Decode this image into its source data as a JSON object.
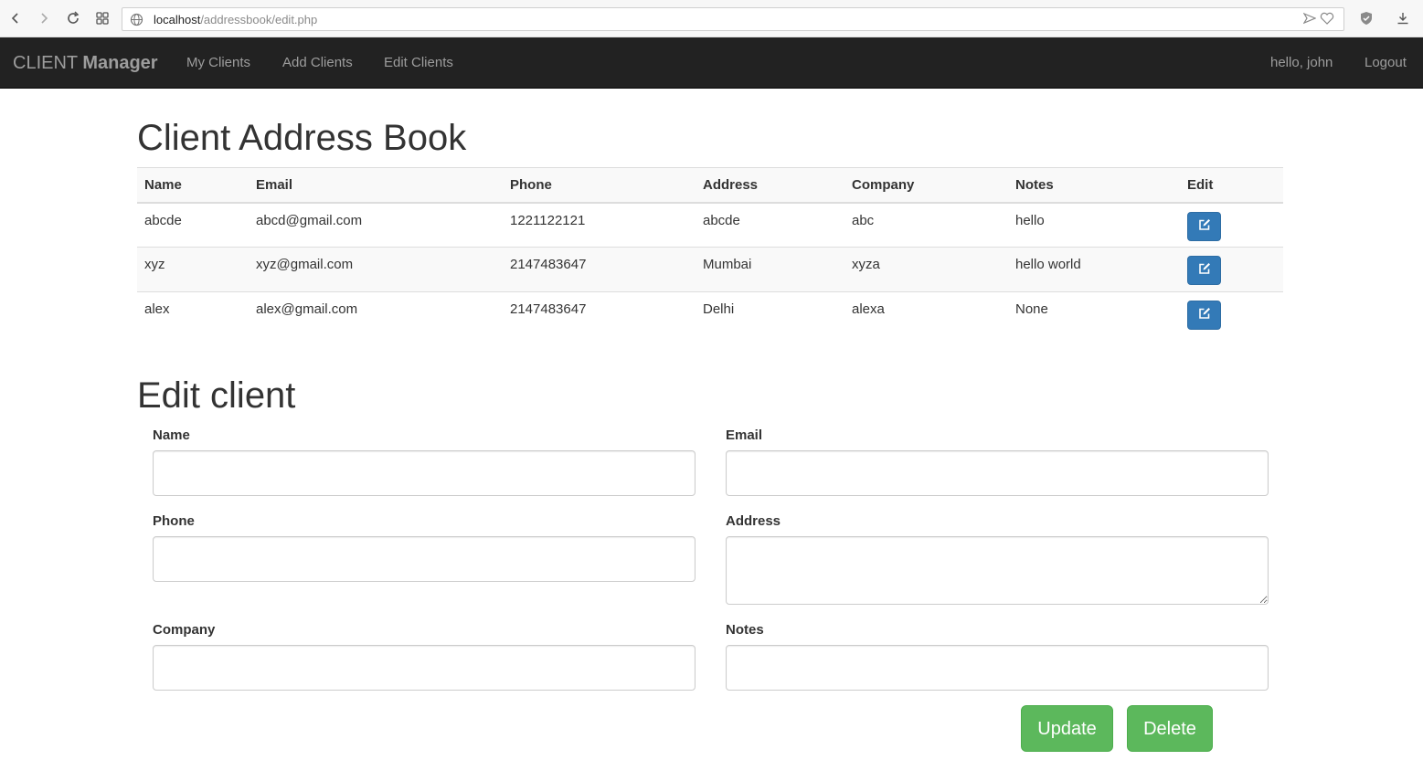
{
  "browser": {
    "url_host": "localhost",
    "url_path": "/addressbook/edit.php"
  },
  "navbar": {
    "brand_light": "CLIENT ",
    "brand_bold": "Manager",
    "links": [
      "My Clients",
      "Add Clients",
      "Edit Clients"
    ],
    "greeting": "hello, john",
    "logout": "Logout"
  },
  "page_title": "Client Address Book",
  "table": {
    "headers": [
      "Name",
      "Email",
      "Phone",
      "Address",
      "Company",
      "Notes",
      "Edit"
    ],
    "rows": [
      {
        "name": "abcde",
        "email": "abcd@gmail.com",
        "phone": "1221122121",
        "address": "abcde",
        "company": "abc",
        "notes": "hello"
      },
      {
        "name": "xyz",
        "email": "xyz@gmail.com",
        "phone": "2147483647",
        "address": "Mumbai",
        "company": "xyza",
        "notes": "hello world"
      },
      {
        "name": "alex",
        "email": "alex@gmail.com",
        "phone": "2147483647",
        "address": "Delhi",
        "company": "alexa",
        "notes": "None"
      }
    ],
    "edit_icon": "edit-square-icon"
  },
  "form": {
    "title": "Edit client",
    "labels": {
      "name": "Name",
      "email": "Email",
      "phone": "Phone",
      "address": "Address",
      "company": "Company",
      "notes": "Notes"
    },
    "values": {
      "name": "",
      "email": "",
      "phone": "",
      "address": "",
      "company": "",
      "notes": ""
    },
    "update_label": "Update",
    "delete_label": "Delete"
  },
  "colors": {
    "navbar_bg": "#222222",
    "nav_text": "#9d9d9d",
    "primary": "#337ab7",
    "success": "#5cb85c"
  }
}
